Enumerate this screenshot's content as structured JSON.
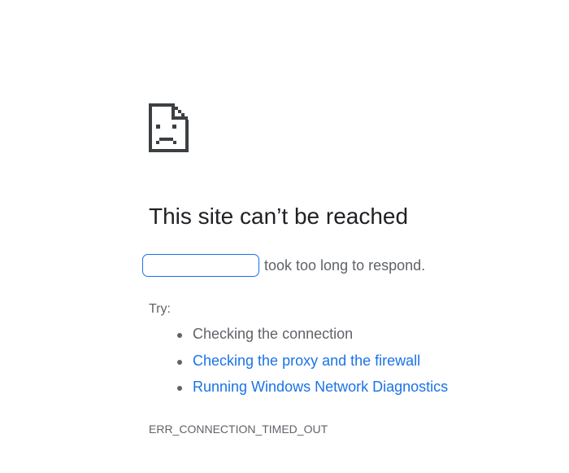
{
  "error_page": {
    "icon": "sad-page-icon",
    "title": "This site can’t be reached",
    "host_value": "",
    "message": "took too long to respond.",
    "try_label": "Try:",
    "suggestions": [
      {
        "label": "Checking the connection",
        "is_link": false
      },
      {
        "label": "Checking the proxy and the firewall",
        "is_link": true
      },
      {
        "label": "Running Windows Network Diagnostics",
        "is_link": true
      }
    ],
    "error_code": "ERR_CONNECTION_TIMED_OUT"
  },
  "colors": {
    "link": "#1a73e8",
    "text_primary": "#202124",
    "text_secondary": "#5f6368",
    "icon": "#3c4043"
  }
}
